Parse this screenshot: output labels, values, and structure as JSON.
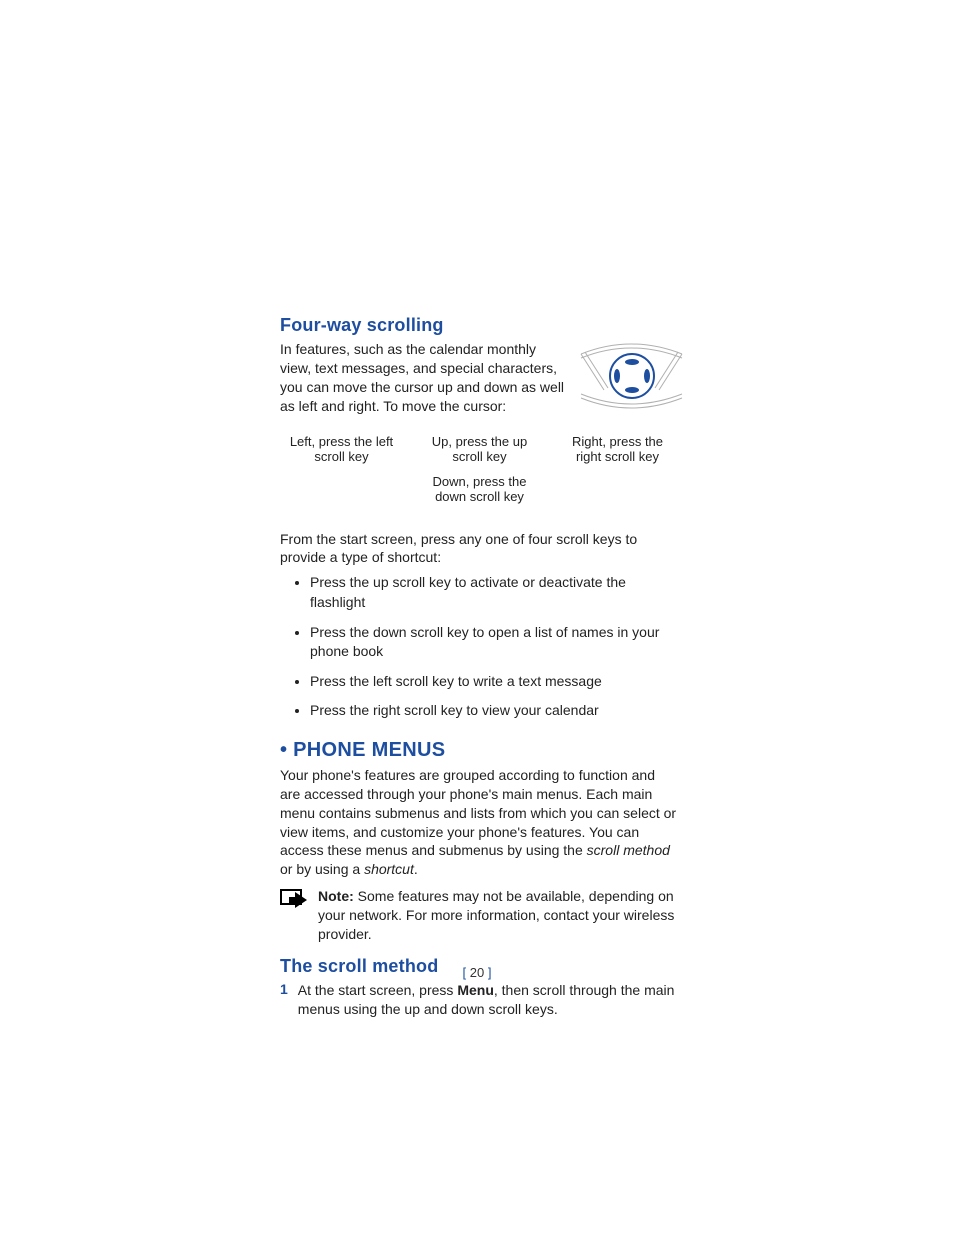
{
  "section1": {
    "heading": "Four-way scrolling",
    "intro": "In features, such as the calendar monthly view, text messages, and special characters, you can move the cursor up and down as well as left and right. To move the cursor:",
    "dir_left": "Left, press the left scroll key",
    "dir_up": "Up, press the up scroll key",
    "dir_down": "Down, press the down scroll key",
    "dir_right": "Right, press the right scroll key",
    "shortcut_intro": "From the start screen, press any one of four scroll keys to provide a type of shortcut:",
    "bullets": [
      "Press the up scroll key to activate or deactivate the flashlight",
      "Press the down scroll key to open a list of names in your phone book",
      "Press the left scroll key to write a text message",
      "Press the right scroll key to view your calendar"
    ]
  },
  "section2": {
    "heading": "PHONE MENUS",
    "para_a": "Your phone's features are grouped according to function and are accessed through your phone's main menus. Each main menu contains submenus and lists from which you can select or view items, and customize your phone's features. You can access these menus and submenus by using the ",
    "para_i1": "scroll method",
    "para_mid": " or by using a ",
    "para_i2": "shortcut",
    "para_end": ".",
    "note_label": "Note:",
    "note_text": " Some features may not be available, depending on your network. For more information, contact your wireless provider."
  },
  "section3": {
    "heading": "The scroll method",
    "num": "1",
    "step_a": "At the start screen, press ",
    "step_b": "Menu",
    "step_c": ", then scroll through the main menus using the up and down scroll keys."
  },
  "pagenum": "20"
}
